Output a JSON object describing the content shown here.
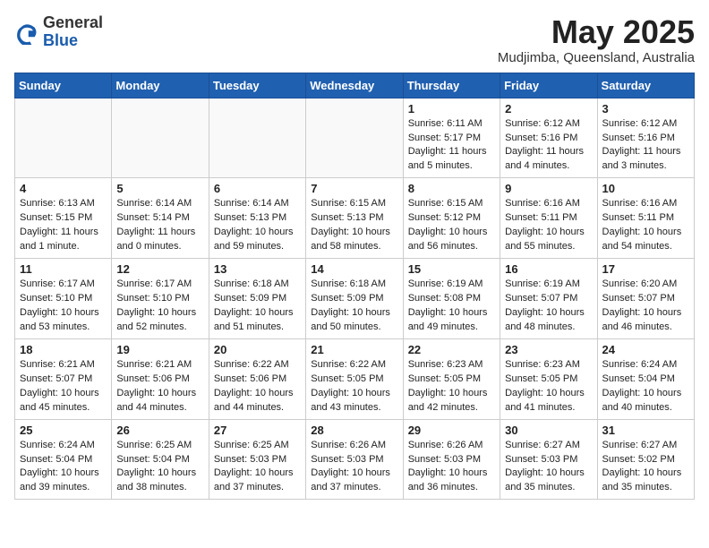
{
  "logo": {
    "general": "General",
    "blue": "Blue"
  },
  "title": {
    "month": "May 2025",
    "location": "Mudjimba, Queensland, Australia"
  },
  "weekdays": [
    "Sunday",
    "Monday",
    "Tuesday",
    "Wednesday",
    "Thursday",
    "Friday",
    "Saturday"
  ],
  "weeks": [
    [
      {
        "day": "",
        "info": ""
      },
      {
        "day": "",
        "info": ""
      },
      {
        "day": "",
        "info": ""
      },
      {
        "day": "",
        "info": ""
      },
      {
        "day": "1",
        "info": "Sunrise: 6:11 AM\nSunset: 5:17 PM\nDaylight: 11 hours\nand 5 minutes."
      },
      {
        "day": "2",
        "info": "Sunrise: 6:12 AM\nSunset: 5:16 PM\nDaylight: 11 hours\nand 4 minutes."
      },
      {
        "day": "3",
        "info": "Sunrise: 6:12 AM\nSunset: 5:16 PM\nDaylight: 11 hours\nand 3 minutes."
      }
    ],
    [
      {
        "day": "4",
        "info": "Sunrise: 6:13 AM\nSunset: 5:15 PM\nDaylight: 11 hours\nand 1 minute."
      },
      {
        "day": "5",
        "info": "Sunrise: 6:14 AM\nSunset: 5:14 PM\nDaylight: 11 hours\nand 0 minutes."
      },
      {
        "day": "6",
        "info": "Sunrise: 6:14 AM\nSunset: 5:13 PM\nDaylight: 10 hours\nand 59 minutes."
      },
      {
        "day": "7",
        "info": "Sunrise: 6:15 AM\nSunset: 5:13 PM\nDaylight: 10 hours\nand 58 minutes."
      },
      {
        "day": "8",
        "info": "Sunrise: 6:15 AM\nSunset: 5:12 PM\nDaylight: 10 hours\nand 56 minutes."
      },
      {
        "day": "9",
        "info": "Sunrise: 6:16 AM\nSunset: 5:11 PM\nDaylight: 10 hours\nand 55 minutes."
      },
      {
        "day": "10",
        "info": "Sunrise: 6:16 AM\nSunset: 5:11 PM\nDaylight: 10 hours\nand 54 minutes."
      }
    ],
    [
      {
        "day": "11",
        "info": "Sunrise: 6:17 AM\nSunset: 5:10 PM\nDaylight: 10 hours\nand 53 minutes."
      },
      {
        "day": "12",
        "info": "Sunrise: 6:17 AM\nSunset: 5:10 PM\nDaylight: 10 hours\nand 52 minutes."
      },
      {
        "day": "13",
        "info": "Sunrise: 6:18 AM\nSunset: 5:09 PM\nDaylight: 10 hours\nand 51 minutes."
      },
      {
        "day": "14",
        "info": "Sunrise: 6:18 AM\nSunset: 5:09 PM\nDaylight: 10 hours\nand 50 minutes."
      },
      {
        "day": "15",
        "info": "Sunrise: 6:19 AM\nSunset: 5:08 PM\nDaylight: 10 hours\nand 49 minutes."
      },
      {
        "day": "16",
        "info": "Sunrise: 6:19 AM\nSunset: 5:07 PM\nDaylight: 10 hours\nand 48 minutes."
      },
      {
        "day": "17",
        "info": "Sunrise: 6:20 AM\nSunset: 5:07 PM\nDaylight: 10 hours\nand 46 minutes."
      }
    ],
    [
      {
        "day": "18",
        "info": "Sunrise: 6:21 AM\nSunset: 5:07 PM\nDaylight: 10 hours\nand 45 minutes."
      },
      {
        "day": "19",
        "info": "Sunrise: 6:21 AM\nSunset: 5:06 PM\nDaylight: 10 hours\nand 44 minutes."
      },
      {
        "day": "20",
        "info": "Sunrise: 6:22 AM\nSunset: 5:06 PM\nDaylight: 10 hours\nand 44 minutes."
      },
      {
        "day": "21",
        "info": "Sunrise: 6:22 AM\nSunset: 5:05 PM\nDaylight: 10 hours\nand 43 minutes."
      },
      {
        "day": "22",
        "info": "Sunrise: 6:23 AM\nSunset: 5:05 PM\nDaylight: 10 hours\nand 42 minutes."
      },
      {
        "day": "23",
        "info": "Sunrise: 6:23 AM\nSunset: 5:05 PM\nDaylight: 10 hours\nand 41 minutes."
      },
      {
        "day": "24",
        "info": "Sunrise: 6:24 AM\nSunset: 5:04 PM\nDaylight: 10 hours\nand 40 minutes."
      }
    ],
    [
      {
        "day": "25",
        "info": "Sunrise: 6:24 AM\nSunset: 5:04 PM\nDaylight: 10 hours\nand 39 minutes."
      },
      {
        "day": "26",
        "info": "Sunrise: 6:25 AM\nSunset: 5:04 PM\nDaylight: 10 hours\nand 38 minutes."
      },
      {
        "day": "27",
        "info": "Sunrise: 6:25 AM\nSunset: 5:03 PM\nDaylight: 10 hours\nand 37 minutes."
      },
      {
        "day": "28",
        "info": "Sunrise: 6:26 AM\nSunset: 5:03 PM\nDaylight: 10 hours\nand 37 minutes."
      },
      {
        "day": "29",
        "info": "Sunrise: 6:26 AM\nSunset: 5:03 PM\nDaylight: 10 hours\nand 36 minutes."
      },
      {
        "day": "30",
        "info": "Sunrise: 6:27 AM\nSunset: 5:03 PM\nDaylight: 10 hours\nand 35 minutes."
      },
      {
        "day": "31",
        "info": "Sunrise: 6:27 AM\nSunset: 5:02 PM\nDaylight: 10 hours\nand 35 minutes."
      }
    ]
  ]
}
